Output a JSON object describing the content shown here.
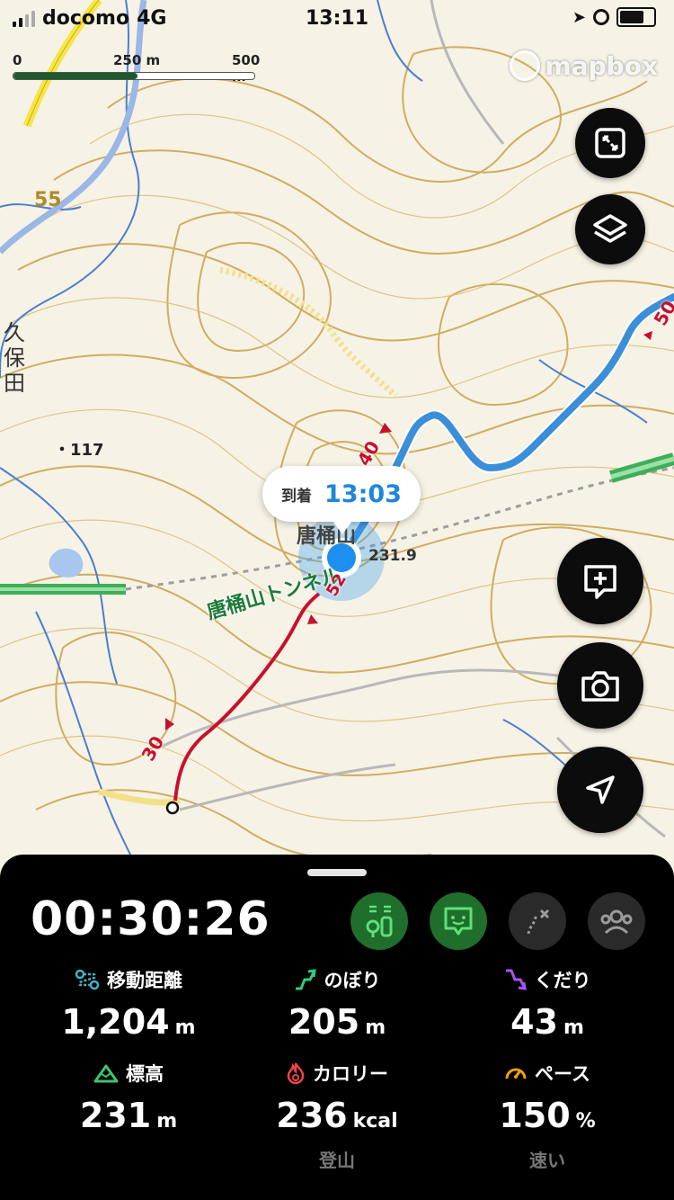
{
  "status_bar": {
    "carrier": "docomo",
    "network": "4G",
    "time": "13:11"
  },
  "map": {
    "scale": {
      "zero": "0",
      "mid": "250 m",
      "end": "500 m"
    },
    "attribution": "mapbox",
    "labels": {
      "road_55": "55",
      "village": "久\n保\n田",
      "spot_height": "・117",
      "summit_name": "唐桶山",
      "summit_elev": "231.9",
      "tunnel": "唐桶山トンネル",
      "route_mark_30": "30",
      "route_mark_40": "40",
      "route_mark_50": "50",
      "route_mark_52": "52"
    },
    "arrival_callout": {
      "label": "到着",
      "time": "13:03"
    }
  },
  "panel": {
    "elapsed_time": "00:30:26",
    "stats": [
      {
        "key": "distance",
        "label": "移動距離",
        "value": "1,204",
        "unit": "m",
        "icon": "route-icon",
        "color": "#3fb3c9"
      },
      {
        "key": "ascent",
        "label": "のぼり",
        "value": "205",
        "unit": "m",
        "icon": "ascent-icon",
        "color": "#2fcf7e"
      },
      {
        "key": "descent",
        "label": "くだり",
        "value": "43",
        "unit": "m",
        "icon": "descent-icon",
        "color": "#a855f7"
      },
      {
        "key": "altitude",
        "label": "標高",
        "value": "231",
        "unit": "m",
        "icon": "mountain-icon",
        "color": "#3ec46a"
      },
      {
        "key": "calories",
        "label": "カロリー",
        "value": "236",
        "unit": "kcal",
        "icon": "flame-icon",
        "color": "#ef4444"
      },
      {
        "key": "pace",
        "label": "ペース",
        "value": "150",
        "unit": "%",
        "icon": "gauge-icon",
        "color": "#f59e0b"
      }
    ],
    "footnotes": {
      "activity_type": "登山",
      "pace_rating": "速い"
    }
  },
  "colors": {
    "route_blue": "#3a8fd8",
    "track_red": "#c8102e",
    "contour": "#c9a24a",
    "active_green": "#1f6e2c",
    "panel_bg": "#000000"
  }
}
